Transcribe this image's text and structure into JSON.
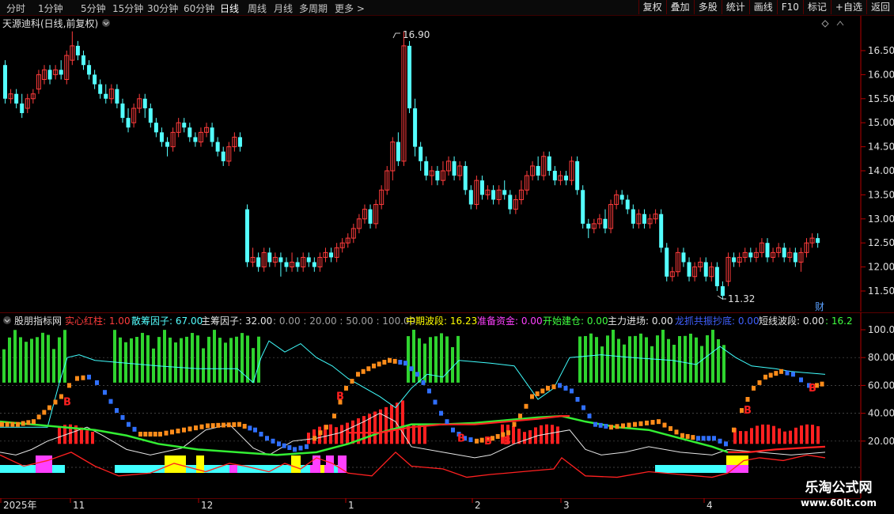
{
  "toolbar": {
    "periods": [
      "分时",
      "1分钟",
      "5分钟",
      "15分钟",
      "30分钟",
      "60分钟",
      "日线",
      "周线",
      "月线",
      "多周期",
      "更多 >"
    ],
    "active_period": "日线",
    "right_buttons": [
      "复权",
      "叠加",
      "多股",
      "统计",
      "画线",
      "F10",
      "标记",
      "+自选",
      "返回"
    ]
  },
  "main_chart": {
    "title": "天源迪科(日线,前复权)",
    "high_label": "16.90",
    "low_label": "11.32",
    "finance_badge": "财",
    "y_ticks": [
      "16.50",
      "16.00",
      "15.50",
      "15.00",
      "14.50",
      "14.00",
      "13.50",
      "13.00",
      "12.50",
      "12.00",
      "11.50"
    ],
    "colors": {
      "up": "#ff3c3c",
      "down": "#54ffff",
      "axis": "#b40000"
    }
  },
  "indicator_panel": {
    "name": "股朋指标网",
    "legend": [
      {
        "label": "实心红柱: 1.00",
        "color": "#ff3c3c"
      },
      {
        "label": "散筹因子: 67.00",
        "color": "#54ffff"
      },
      {
        "label": "主筹因子: 32.00",
        "color": "#e6e6e6"
      },
      {
        "label": ": 0.00 : 20.00 : 50.00 : 100.00",
        "color": "#a0a0a0"
      },
      {
        "label": "中期波段: 16.23",
        "color": "#ffff00"
      },
      {
        "label": "准备资金: 0.00",
        "color": "#ff40ff"
      },
      {
        "label": "开始建仓: 0.00",
        "color": "#40ff40"
      },
      {
        "label": "主力进场: 0.00",
        "color": "#e6e6e6"
      },
      {
        "label": "龙抓共振抄底: 0.00",
        "color": "#4060ff"
      },
      {
        "label": "短线波段: 0.00",
        "color": "#e6e6e6"
      },
      {
        "label": ": 16.2",
        "color": "#40ff40"
      }
    ],
    "y_ticks": [
      "100.0",
      "80.00",
      "60.00",
      "40.00",
      "20.00"
    ],
    "b_marker": "B"
  },
  "x_axis": {
    "labels": [
      "2025年",
      "11",
      "12",
      "1",
      "2",
      "3",
      "4"
    ]
  },
  "watermark": {
    "line1": "乐淘公式网",
    "line2": "www.60lt.com"
  }
}
